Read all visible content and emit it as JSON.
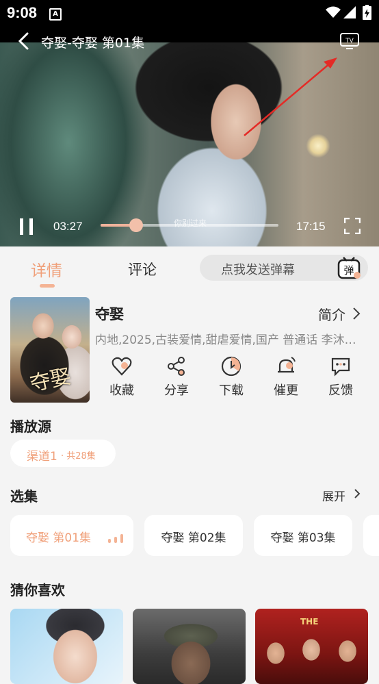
{
  "status_bar": {
    "time": "9:08",
    "notif_icon": "A"
  },
  "player": {
    "title": "夺娶-夺娶 第01集",
    "current_time": "03:27",
    "duration": "17:15",
    "progress": 0.2,
    "subtitle": "你别过来",
    "accent": "#f0b39b"
  },
  "tabs": {
    "detail": "详情",
    "comments": "评论",
    "danmu_placeholder": "点我发送弹幕",
    "danmu_icon_text": "弹"
  },
  "show": {
    "poster_logo": "夺娶",
    "title": "夺娶",
    "intro_label": "简介",
    "meta": "内地,2025,古装爱情,甜虐爱情,国产 普通话 李沐…"
  },
  "actions": [
    {
      "label": "收藏",
      "icon": "heart-icon"
    },
    {
      "label": "分享",
      "icon": "share-icon"
    },
    {
      "label": "下载",
      "icon": "download-icon"
    },
    {
      "label": "催更",
      "icon": "bell-icon"
    },
    {
      "label": "反馈",
      "icon": "feedback-icon"
    }
  ],
  "sources": {
    "title": "播放源",
    "channel": "渠道1",
    "count": "· 共28集"
  },
  "episodes": {
    "title": "选集",
    "expand_label": "展开",
    "items": [
      "夺娶 第01集",
      "夺娶 第02集",
      "夺娶 第03集"
    ]
  },
  "recommend": {
    "title": "猜你喜欢",
    "poster3_text": "THE"
  },
  "colors": {
    "accent": "#f0a07a",
    "background": "#f4f4f4"
  }
}
